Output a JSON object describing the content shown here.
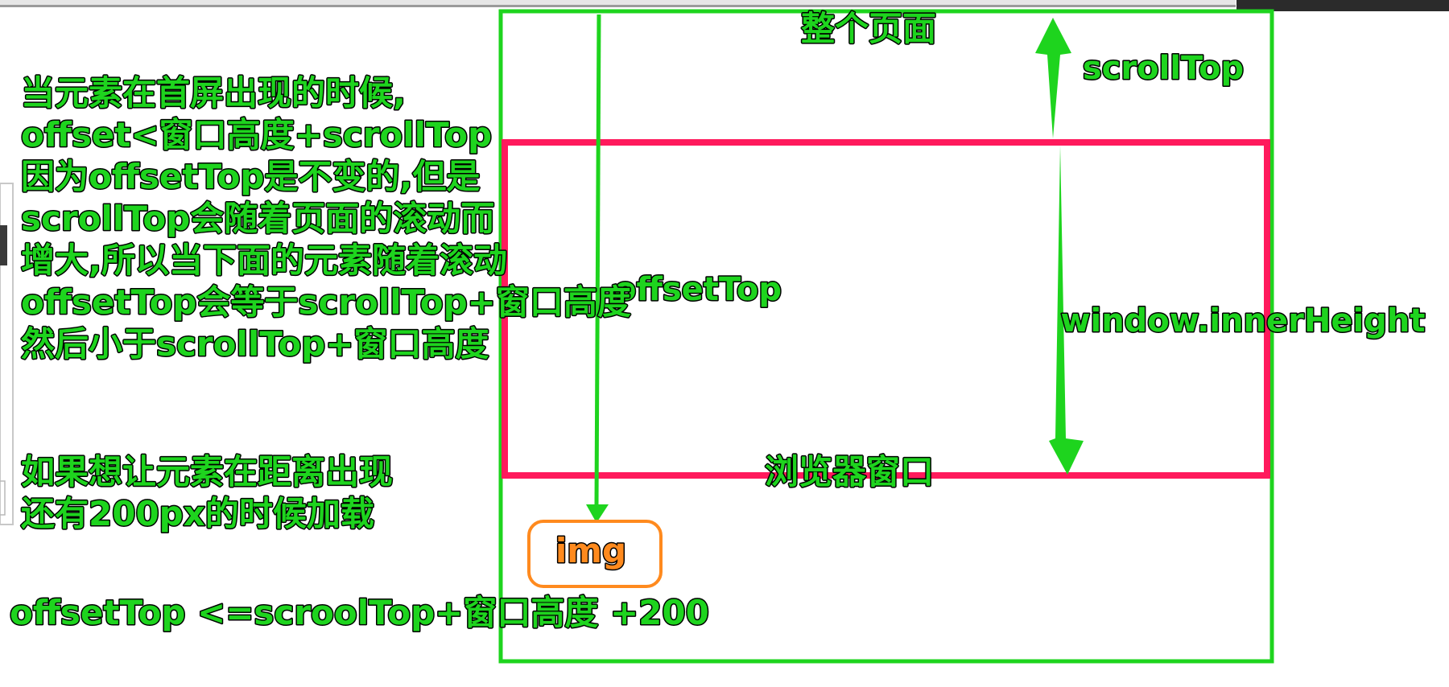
{
  "explanation": {
    "lines": [
      "当元素在首屏出现的时候,",
      "offset<窗口高度+scrollTop",
      "因为offsetTop是不变的,但是",
      "scrollTop会随着页面的滚动而",
      "增大,所以当下面的元素随着滚动",
      "offsetTop会等于scrollTop+窗口高度",
      "然后小于scrollTop+窗口高度"
    ]
  },
  "preload_note": {
    "lines": [
      "如果想让元素在距离出现",
      "还有200px的时候加载"
    ]
  },
  "formula": "offsetTop <=scroolTop+窗口高度 +200",
  "labels": {
    "whole_page": "整个页面",
    "scroll_top": "scrollTop",
    "offset_top": "offsetTop",
    "inner_height": "window.innerHeight",
    "browser_window": "浏览器窗口",
    "img": "img"
  },
  "colors": {
    "page_border": "#1ed41e",
    "window_border": "#ff1a5c",
    "arrow": "#1ed41e",
    "label_text": "#1ed41e",
    "img_border": "#ff8a1e",
    "img_text": "#ff8a1e",
    "text_outline": "#000000"
  }
}
